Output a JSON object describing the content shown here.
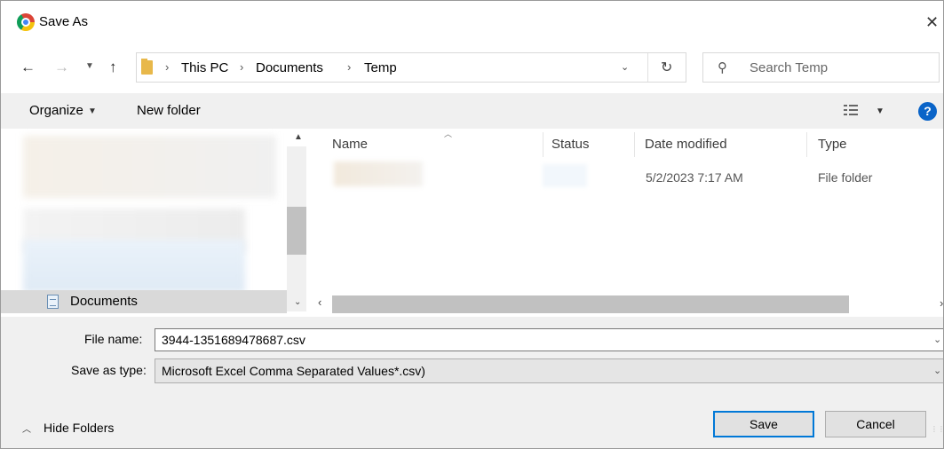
{
  "window": {
    "title": "Save As",
    "close_glyph": "✕"
  },
  "nav": {
    "back_icon": "arrow-left-icon",
    "forward_icon": "arrow-right-icon",
    "up_icon": "arrow-up-icon",
    "breadcrumbs": [
      "This PC",
      "Documents",
      "Temp"
    ],
    "search_placeholder": "Search Temp"
  },
  "toolbar": {
    "organize_label": "Organize",
    "new_folder_label": "New folder"
  },
  "sidebar": {
    "selected_item_label": "Documents"
  },
  "file_list": {
    "columns": [
      "Name",
      "Status",
      "Date modified",
      "Type"
    ],
    "rows": [
      {
        "name": "",
        "status": "",
        "date_modified": "5/2/2023 7:17 AM",
        "type": "File folder"
      }
    ]
  },
  "form": {
    "file_name_label": "File name:",
    "file_name_value": "3944-1351689478687.csv",
    "save_type_label": "Save as type:",
    "save_type_value": "Microsoft Excel Comma Separated Values*.csv)"
  },
  "footer": {
    "hide_folders_label": "Hide Folders",
    "save_label": "Save",
    "cancel_label": "Cancel"
  },
  "colors": {
    "accent": "#0078d7",
    "help_icon": "#0a64c8",
    "folder": "#e8b84a"
  }
}
